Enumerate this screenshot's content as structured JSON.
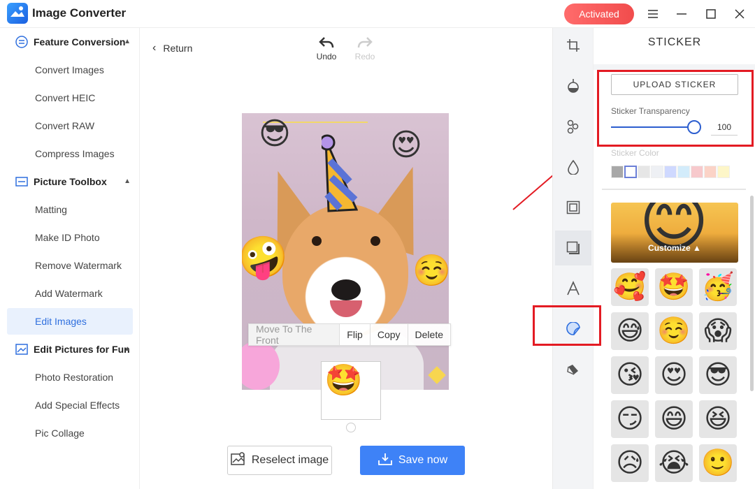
{
  "app": {
    "title": "Image Converter",
    "activated_label": "Activated"
  },
  "sidebar": {
    "sections": [
      {
        "label": "Feature Conversion",
        "items": [
          "Convert Images",
          "Convert HEIC",
          "Convert RAW",
          "Compress Images"
        ]
      },
      {
        "label": "Picture Toolbox",
        "items": [
          "Matting",
          "Make ID Photo",
          "Remove Watermark",
          "Add Watermark",
          "Edit Images"
        ]
      },
      {
        "label": "Edit Pictures for Fun",
        "items": [
          "Photo Restoration",
          "Add Special Effects",
          "Pic Collage"
        ]
      }
    ],
    "active_item": "Edit Images"
  },
  "toolbar": {
    "return_label": "Return",
    "undo_label": "Undo",
    "redo_label": "Redo"
  },
  "context_menu": {
    "items": [
      "Move To The Front",
      "Flip",
      "Copy",
      "Delete"
    ]
  },
  "actions": {
    "reselect_label": "Reselect image",
    "save_label": "Save now"
  },
  "panel": {
    "title": "STICKER",
    "upload_label": "UPLOAD STICKER",
    "transparency_label": "Sticker Transparency",
    "transparency_value": "100",
    "transparency_fraction": 1.0,
    "color_label": "Sticker Color",
    "colors": [
      "#a8a8a8",
      "#ffffff",
      "#e6e6e6",
      "#eef0f4",
      "#cfd9ff",
      "#d3ecfb",
      "#f7c9cc",
      "#fbd3c7",
      "#fdf6c8"
    ],
    "selected_color": 1,
    "banner_label": "Customize ▲",
    "stickers": [
      "🥰",
      "🤩",
      "🥳",
      "😅",
      "☺️",
      "😱",
      "😘",
      "😍",
      "😎",
      "😏",
      "😄",
      "😆",
      "😥",
      "😭",
      "🙂"
    ]
  },
  "canvas_stickers": [
    "😎",
    "😍",
    "🤪",
    "☺️"
  ],
  "selected_sticker": "🤩",
  "colors": {
    "accent": "#3e82f7",
    "activated": "#f14c4c",
    "highlight": "#e31b23"
  }
}
